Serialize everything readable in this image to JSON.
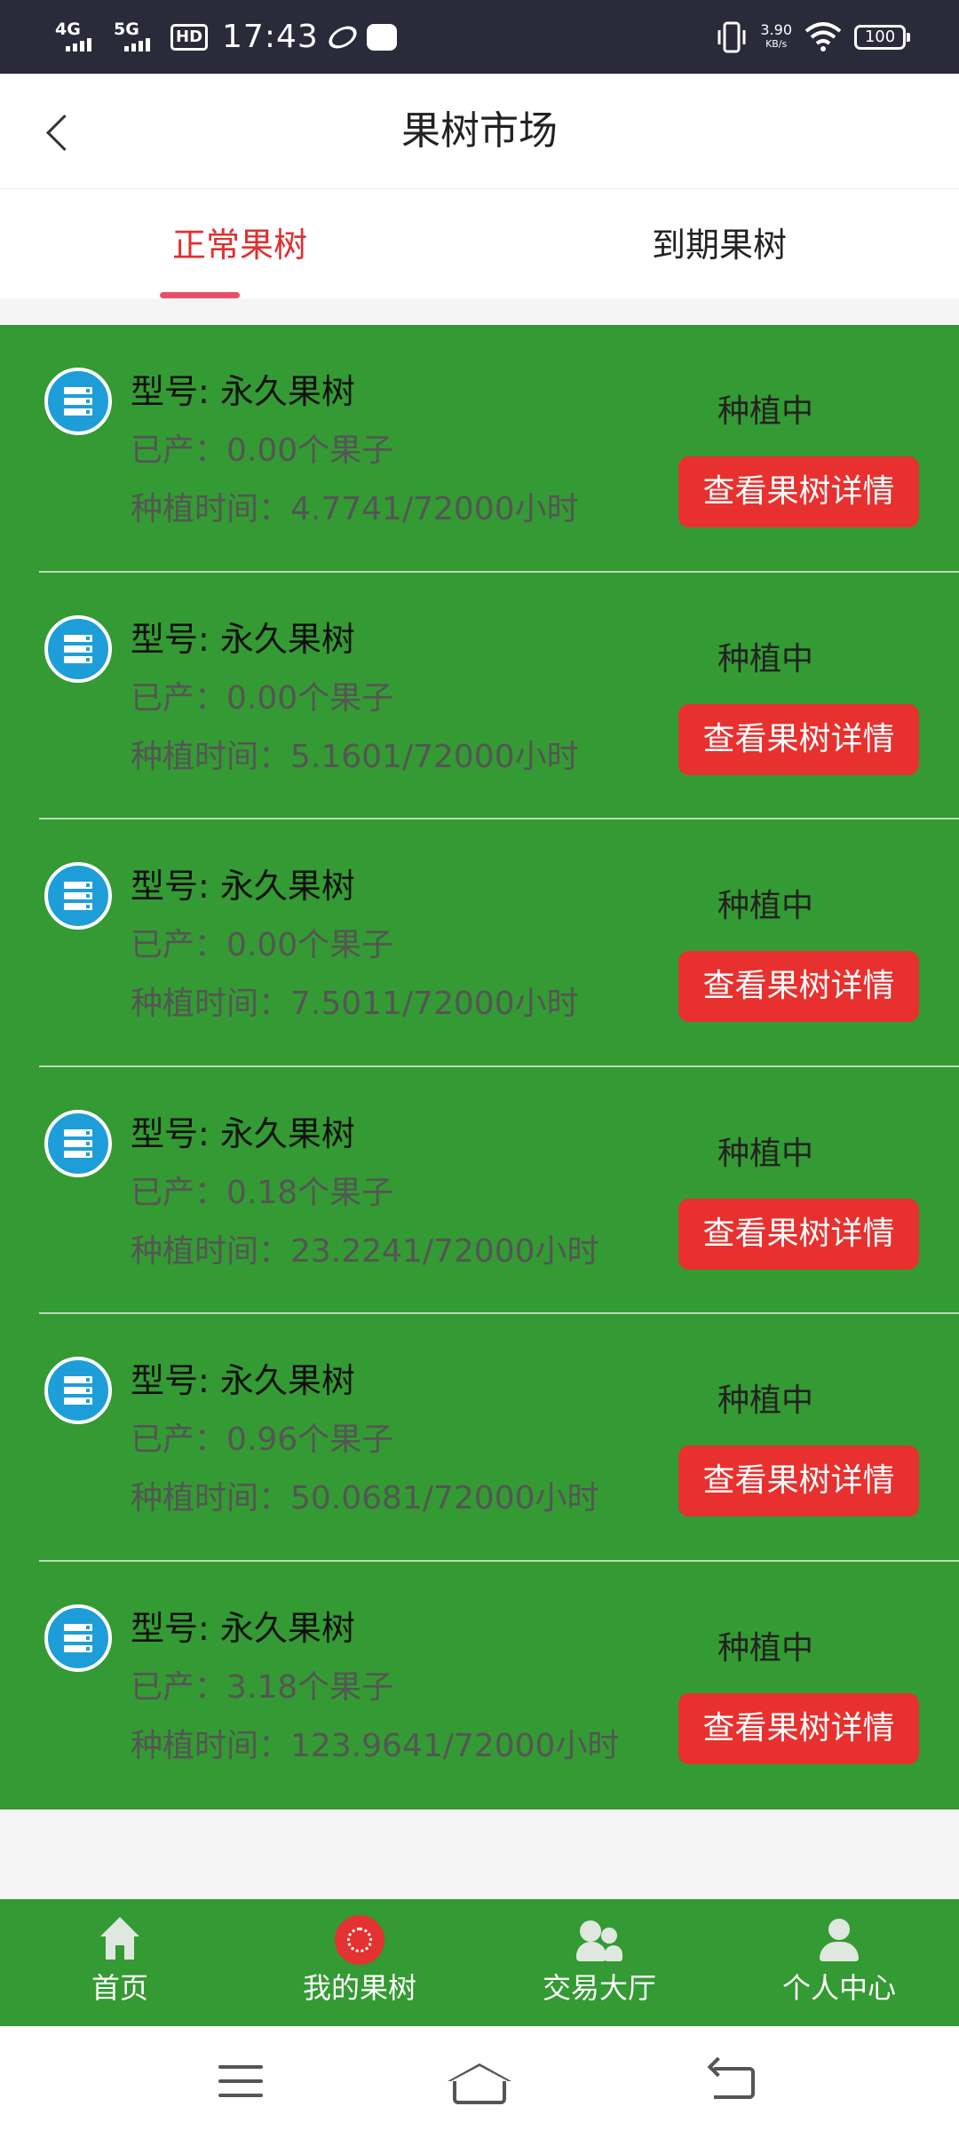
{
  "status_bar": {
    "network1": "4G",
    "network2": "5G",
    "hd": "HD",
    "time": "17:43",
    "speed": "3.90",
    "speed_unit": "KB/s",
    "battery": "100"
  },
  "header": {
    "title": "果树市场",
    "back_icon": "chevron-left-icon"
  },
  "tabs": [
    {
      "label": "正常果树",
      "active": true
    },
    {
      "label": "到期果树",
      "active": false
    }
  ],
  "colors": {
    "list_bg": "#349a33",
    "accent": "#e03030",
    "button": "#e8302e",
    "icon_blue": "#1e9ed8"
  },
  "trees": [
    {
      "model": "型号: 永久果树",
      "produced": "已产：0.00个果子",
      "time": "种植时间：4.7741/72000小时",
      "status": "种植中",
      "button": "查看果树详情"
    },
    {
      "model": "型号: 永久果树",
      "produced": "已产：0.00个果子",
      "time": "种植时间：5.1601/72000小时",
      "status": "种植中",
      "button": "查看果树详情"
    },
    {
      "model": "型号: 永久果树",
      "produced": "已产：0.00个果子",
      "time": "种植时间：7.5011/72000小时",
      "status": "种植中",
      "button": "查看果树详情"
    },
    {
      "model": "型号: 永久果树",
      "produced": "已产：0.18个果子",
      "time": "种植时间：23.2241/72000小时",
      "status": "种植中",
      "button": "查看果树详情"
    },
    {
      "model": "型号: 永久果树",
      "produced": "已产：0.96个果子",
      "time": "种植时间：50.0681/72000小时",
      "status": "种植中",
      "button": "查看果树详情"
    },
    {
      "model": "型号: 永久果树",
      "produced": "已产：3.18个果子",
      "time": "种植时间：123.9641/72000小时",
      "status": "种植中",
      "button": "查看果树详情"
    }
  ],
  "bottom_nav": [
    {
      "label": "首页",
      "icon": "home-icon"
    },
    {
      "label": "我的果树",
      "icon": "tree-icon"
    },
    {
      "label": "交易大厅",
      "icon": "trade-hall-icon"
    },
    {
      "label": "个人中心",
      "icon": "person-icon"
    }
  ],
  "system_nav": {
    "menu_icon": "menu-icon",
    "home_icon": "home-outline-icon",
    "back_icon": "back-icon"
  }
}
